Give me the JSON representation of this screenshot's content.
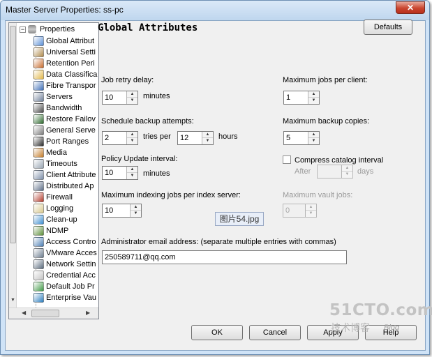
{
  "window": {
    "title": "Master Server Properties: ss-pc",
    "close_glyph": "✕"
  },
  "tree": {
    "root_label": "Properties",
    "expander": "−",
    "items": [
      {
        "label": "Global Attribut",
        "icon": "globe-icon",
        "color": "#5b8fd6"
      },
      {
        "label": "Universal Setti",
        "icon": "universal-settings-icon",
        "color": "#b08a4c"
      },
      {
        "label": "Retention Peri",
        "icon": "clock-icon",
        "color": "#c96d2f"
      },
      {
        "label": "Data Classifica",
        "icon": "data-classification-icon",
        "color": "#e2b84b"
      },
      {
        "label": "Fibre Transpor",
        "icon": "fibre-transport-icon",
        "color": "#3f6fb8"
      },
      {
        "label": "Servers",
        "icon": "servers-icon",
        "color": "#6f7f99"
      },
      {
        "label": "Bandwidth",
        "icon": "bandwidth-icon",
        "color": "#4a4a4a"
      },
      {
        "label": "Restore Failov",
        "icon": "restore-failover-icon",
        "color": "#2e6b2e"
      },
      {
        "label": "General Serve",
        "icon": "general-server-icon",
        "color": "#7b7b7b"
      },
      {
        "label": "Port Ranges",
        "icon": "port-ranges-icon",
        "color": "#2a2a2a"
      },
      {
        "label": "Media",
        "icon": "media-icon",
        "color": "#c47c2a"
      },
      {
        "label": "Timeouts",
        "icon": "timeouts-icon",
        "color": "#9aa6b4"
      },
      {
        "label": "Client Attribute",
        "icon": "client-attributes-icon",
        "color": "#7c8ea8"
      },
      {
        "label": "Distributed Ap",
        "icon": "distributed-app-icon",
        "color": "#5f6f88"
      },
      {
        "label": "Firewall",
        "icon": "firewall-icon",
        "color": "#b43b2c"
      },
      {
        "label": "Logging",
        "icon": "logging-icon",
        "color": "#d9c98d"
      },
      {
        "label": "Clean-up",
        "icon": "clean-up-icon",
        "color": "#3f8fd0"
      },
      {
        "label": "NDMP",
        "icon": "ndmp-icon",
        "color": "#5d8f3a"
      },
      {
        "label": "Access Contro",
        "icon": "access-control-icon",
        "color": "#4d7fb5"
      },
      {
        "label": "VMware Acces",
        "icon": "vmware-access-icon",
        "color": "#6d7d90"
      },
      {
        "label": "Network Settin",
        "icon": "network-settings-icon",
        "color": "#5a6a7d"
      },
      {
        "label": "Credential Acc",
        "icon": "credential-access-icon",
        "color": "#c3c3c3"
      },
      {
        "label": "Default Job Pr",
        "icon": "default-job-priority-icon",
        "color": "#3f9a45"
      },
      {
        "label": "Enterprise Vau",
        "icon": "enterprise-vault-icon",
        "color": "#2f7fbf"
      }
    ]
  },
  "panel": {
    "heading": "Global Attributes",
    "defaults_label": "Defaults",
    "job_retry_delay": {
      "label": "Job retry delay:",
      "value": "10",
      "unit": "minutes"
    },
    "max_jobs_per_client": {
      "label": "Maximum jobs per client:",
      "value": "1"
    },
    "schedule_backup_attempts": {
      "label": "Schedule backup attempts:",
      "value": "2",
      "mid_label": "tries per",
      "per_value": "12",
      "unit": "hours"
    },
    "max_backup_copies": {
      "label": "Maximum backup copies:",
      "value": "5"
    },
    "policy_update_interval": {
      "label": "Policy Update interval:",
      "value": "10",
      "unit": "minutes"
    },
    "compress_catalog": {
      "label": "Compress catalog interval",
      "checked": false,
      "after_label": "After",
      "value": "",
      "unit": "days"
    },
    "max_indexing_jobs": {
      "label": "Maximum indexing jobs per index server:",
      "value": "10"
    },
    "max_vault_jobs": {
      "label": "Maximum vault jobs:",
      "value": "0"
    },
    "admin_email": {
      "label": "Administrator email address: (separate multiple entries with commas)",
      "value": "250589711@qq.com"
    },
    "image_tag": "图片54.jpg"
  },
  "buttons": {
    "ok": "OK",
    "cancel": "Cancel",
    "apply": "Apply",
    "help": "Help"
  },
  "watermark": {
    "site": "51CTO.com",
    "chinese": "技术博客",
    "blog": "Blog"
  }
}
